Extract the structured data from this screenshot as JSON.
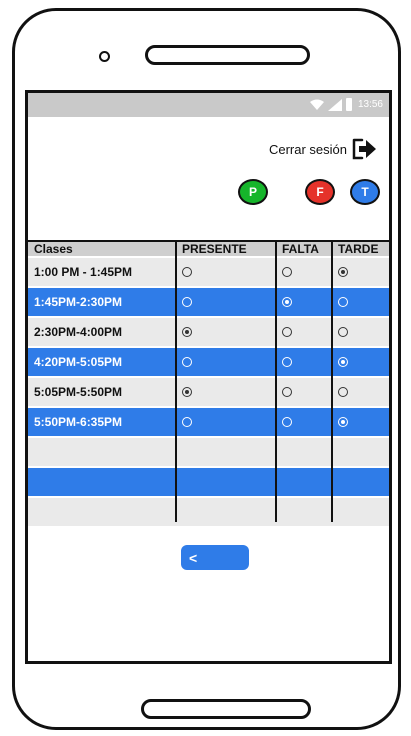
{
  "status_bar": {
    "time": "13:56"
  },
  "header": {
    "logout_label": "Cerrar sesión"
  },
  "legend": [
    {
      "letter": "P",
      "color": "#16b52b"
    },
    {
      "letter": "F",
      "color": "#e5322a"
    },
    {
      "letter": "T",
      "color": "#2f7ce8"
    }
  ],
  "colors": {
    "accent": "#2f7ce8",
    "row_light": "#eaeaea",
    "row_header": "#cfcfcf"
  },
  "table": {
    "columns": [
      "Clases",
      "PRESENTE",
      "FALTA",
      "TARDE"
    ],
    "rows": [
      {
        "label": "1:00 PM - 1:45PM",
        "selected": "TARDE",
        "highlight": false
      },
      {
        "label": "1:45PM-2:30PM",
        "selected": "FALTA",
        "highlight": true
      },
      {
        "label": "2:30PM-4:00PM",
        "selected": "PRESENTE",
        "highlight": false
      },
      {
        "label": "4:20PM-5:05PM",
        "selected": "TARDE",
        "highlight": true
      },
      {
        "label": "5:05PM-5:50PM",
        "selected": "PRESENTE",
        "highlight": false
      },
      {
        "label": "5:50PM-6:35PM",
        "selected": "TARDE",
        "highlight": true
      },
      {
        "label": "",
        "selected": "",
        "highlight": false
      },
      {
        "label": "",
        "selected": "",
        "highlight": true
      },
      {
        "label": "",
        "selected": "",
        "highlight": false
      }
    ]
  },
  "back_button": {
    "label": "<"
  }
}
